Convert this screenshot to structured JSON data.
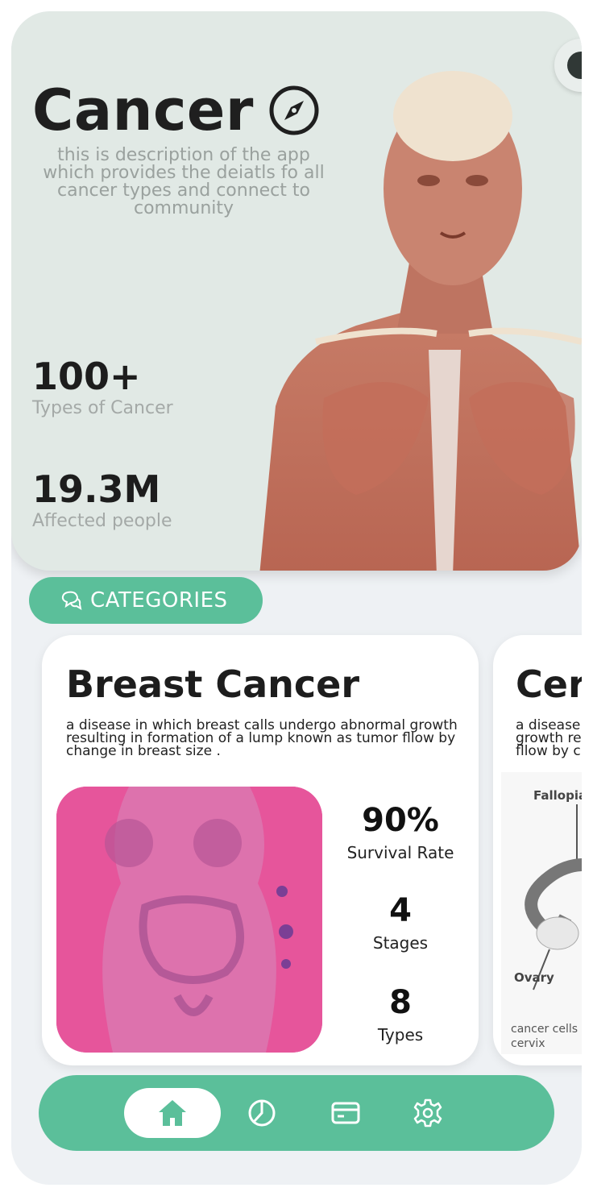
{
  "hero": {
    "title": "Cancer",
    "description": "this is description of the app which provides the deiatls fo all cancer types and connect to community",
    "stats": [
      {
        "value": "100+",
        "label": "Types of Cancer"
      },
      {
        "value": "19.3M",
        "label": "Affected people"
      }
    ]
  },
  "categories": {
    "label": "CATEGORIES",
    "icon": "chat-bubbles-icon"
  },
  "cards": [
    {
      "title": "Breast Cancer",
      "description": "a disease in which breast calls undergo abnormal growth resulting in formation of a lump known as tumor fllow by change in breast size .",
      "metrics": [
        {
          "value": "90%",
          "label": "Survival Rate"
        },
        {
          "value": "4",
          "label": "Stages"
        },
        {
          "value": "8",
          "label": "Types"
        }
      ]
    },
    {
      "title": "Cer",
      "description": "a disease\ngrowth re\nfllow by c",
      "image_labels": {
        "fallopian": "Fallopia",
        "ovary": "Ovary",
        "cervix": "cancer cells at cervix"
      }
    }
  ],
  "nav": {
    "items": [
      "home-icon",
      "pie-chart-icon",
      "credit-card-icon",
      "settings-icon"
    ],
    "active": "home-icon"
  },
  "colors": {
    "accent": "#5bbf9a",
    "hero_bg": "#e1e9e5",
    "card_image": "#e6559b"
  }
}
